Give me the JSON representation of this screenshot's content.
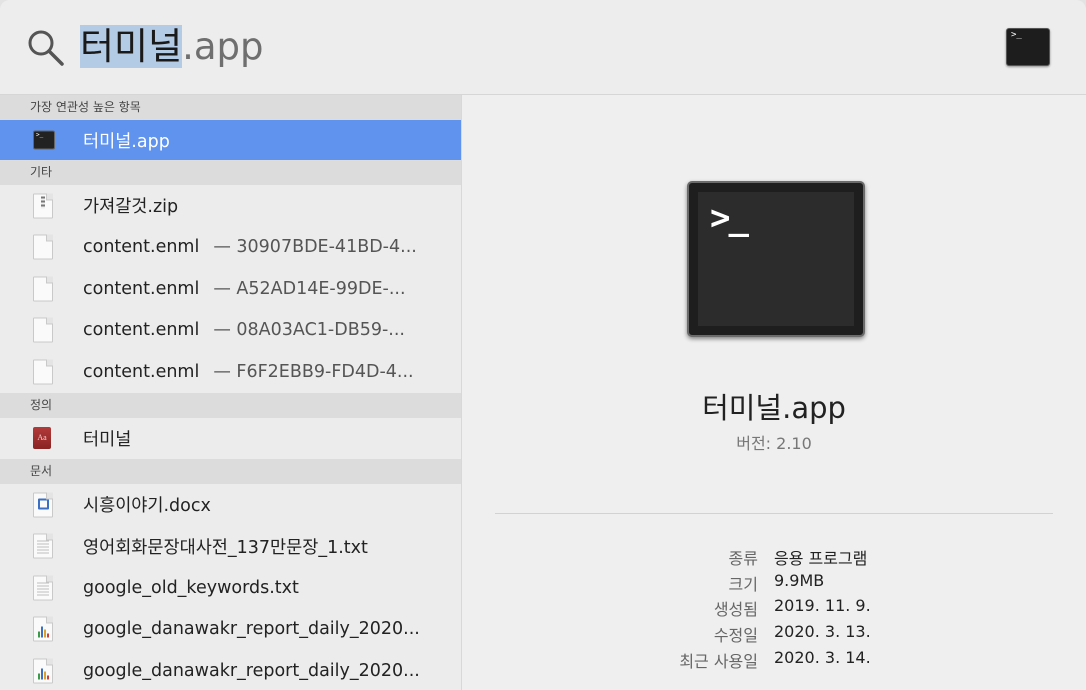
{
  "search": {
    "query_selected": "터미널",
    "query_rest": ".app"
  },
  "sections": {
    "top_hit": "가장 연관성 높은 항목",
    "other": "기타",
    "definition": "정의",
    "documents": "문서"
  },
  "top_hit": {
    "label": "터미널.app",
    "icon": "terminal-icon"
  },
  "other_items": [
    {
      "label": "가져갈것.zip",
      "sub": "",
      "icon": "zip-file-icon"
    },
    {
      "label": "content.enml",
      "sub": "— 30907BDE-41BD-4...",
      "icon": "document-icon"
    },
    {
      "label": "content.enml",
      "sub": "— A52AD14E-99DE-...",
      "icon": "document-icon"
    },
    {
      "label": "content.enml",
      "sub": "— 08A03AC1-DB59-...",
      "icon": "document-icon"
    },
    {
      "label": "content.enml",
      "sub": "— F6F2EBB9-FD4D-4...",
      "icon": "document-icon"
    }
  ],
  "definition_items": [
    {
      "label": "터미널",
      "icon": "dictionary-icon"
    }
  ],
  "document_items": [
    {
      "label": "시흥이야기.docx",
      "icon": "word-document-icon"
    },
    {
      "label": "영어회화문장대사전_137만문장_1.txt",
      "icon": "text-file-icon"
    },
    {
      "label": "google_old_keywords.txt",
      "icon": "text-file-icon"
    },
    {
      "label": "google_danawakr_report_daily_2020...",
      "icon": "spreadsheet-icon"
    },
    {
      "label": "google_danawakr_report_daily_2020...",
      "icon": "spreadsheet-icon"
    }
  ],
  "preview": {
    "app_name": "터미널.app",
    "version": "버전: 2.10",
    "prompt_glyph": ">_",
    "meta": [
      {
        "key": "종류",
        "value": "응용 프로그램"
      },
      {
        "key": "크기",
        "value": "9.9MB"
      },
      {
        "key": "생성됨",
        "value": "2019. 11. 9."
      },
      {
        "key": "수정일",
        "value": "2020. 3. 13."
      },
      {
        "key": "최근 사용일",
        "value": "2020. 3. 14."
      }
    ]
  },
  "colors": {
    "selection": "#5f93ee",
    "query_highlight": "#b4cbe6"
  }
}
